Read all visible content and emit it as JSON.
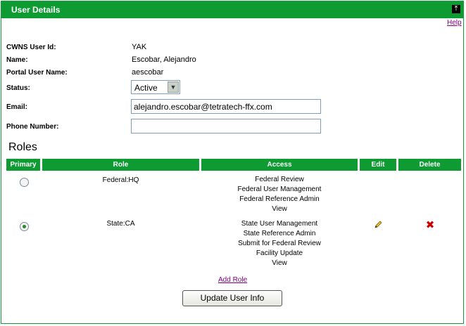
{
  "panel": {
    "title": "User Details",
    "top_button_glyph": "⤒",
    "help_link": "Help"
  },
  "user": {
    "user_id_label": "CWNS User Id:",
    "user_id": "YAK",
    "name_label": "Name:",
    "name": "Escobar, Alejandro",
    "portal_label": "Portal User Name:",
    "portal_name": "aescobar",
    "status_label": "Status:",
    "status": "Active",
    "email_label": "Email:",
    "email": "alejandro.escobar@tetratech-ffx.com",
    "phone_label": "Phone Number:",
    "phone": ""
  },
  "roles": {
    "heading": "Roles",
    "columns": [
      "Primary",
      "Role",
      "Access",
      "Edit",
      "Delete"
    ],
    "rows": [
      {
        "role": "Federal:HQ",
        "primary": false,
        "access": [
          "Federal Review",
          "Federal User Management",
          "Federal Reference Admin",
          "View"
        ],
        "editable": false,
        "deletable": false
      },
      {
        "role": "State:CA",
        "primary": true,
        "access": [
          "State User Management",
          "State Reference Admin",
          "Submit for Federal Review",
          "Facility Update",
          "View"
        ],
        "editable": true,
        "deletable": true
      }
    ],
    "add_role_link": "Add Role"
  },
  "actions": {
    "update_button": "Update User Info"
  },
  "colors": {
    "header_green": "#0d9b32",
    "link_purple": "#800080",
    "delete_red": "#cc0000"
  }
}
